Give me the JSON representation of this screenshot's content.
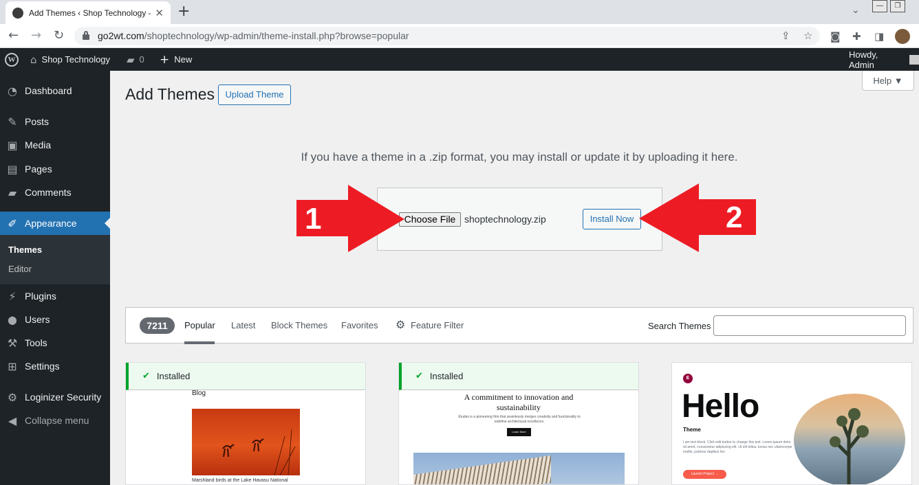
{
  "browser": {
    "tab_title": "Add Themes ‹ Shop Technology —",
    "url_host": "go2wt.com",
    "url_path": "/shoptechnology/wp-admin/theme-install.php?browse=popular"
  },
  "adminbar": {
    "site_name": "Shop Technology",
    "comments_count": "0",
    "new_label": "New",
    "howdy": "Howdy, Admin"
  },
  "sidebar": {
    "items": [
      {
        "label": "Dashboard",
        "icon": "dashboard-icon"
      },
      {
        "label": "Posts",
        "icon": "pin-icon"
      },
      {
        "label": "Media",
        "icon": "media-icon"
      },
      {
        "label": "Pages",
        "icon": "pages-icon"
      },
      {
        "label": "Comments",
        "icon": "comment-icon"
      },
      {
        "label": "Appearance",
        "icon": "brush-icon"
      },
      {
        "label": "Plugins",
        "icon": "plug-icon"
      },
      {
        "label": "Users",
        "icon": "user-icon"
      },
      {
        "label": "Tools",
        "icon": "wrench-icon"
      },
      {
        "label": "Settings",
        "icon": "settings-icon"
      },
      {
        "label": "Loginizer Security",
        "icon": "gear-icon"
      },
      {
        "label": "Collapse menu",
        "icon": "collapse-icon"
      }
    ],
    "submenu": [
      "Themes",
      "Editor"
    ]
  },
  "page": {
    "title": "Add Themes",
    "upload_theme_label": "Upload Theme",
    "help_label": "Help ▼",
    "upload_text": "If you have a theme in a .zip format, you may install or update it by uploading it here.",
    "choose_file_label": "Choose File",
    "file_name": "shoptechnology.zip",
    "install_now_label": "Install Now"
  },
  "annotations": {
    "step1": "1",
    "step2": "2",
    "arrow_color": "#ed1c24"
  },
  "filter": {
    "count": "7211",
    "tabs": [
      "Popular",
      "Latest",
      "Block Themes",
      "Favorites"
    ],
    "feature_filter": "Feature Filter",
    "search_label": "Search Themes"
  },
  "themes": [
    {
      "installed_label": "Installed",
      "preview_title": "Blog",
      "preview_caption": "Marshland birds at the Lake Havasu National"
    },
    {
      "installed_label": "Installed",
      "preview_heading": "A commitment to innovation and sustainability",
      "preview_sub": "Études is a pioneering firm that seamlessly merges creativity and functionality to redefine architectural excellence.",
      "preview_button": "Learn More"
    },
    {
      "preview_logo": "E",
      "preview_title": "Hello",
      "preview_sub": "Theme",
      "preview_text": "I am text block. Click edit button to change this text. Lorem ipsum dolor sit amet, consectetur adipiscing elit. Ut elit tellus, luctus nec ullamcorper mattis, pulvinar dapibus leo.",
      "preview_button": "Launch Project →"
    }
  ]
}
